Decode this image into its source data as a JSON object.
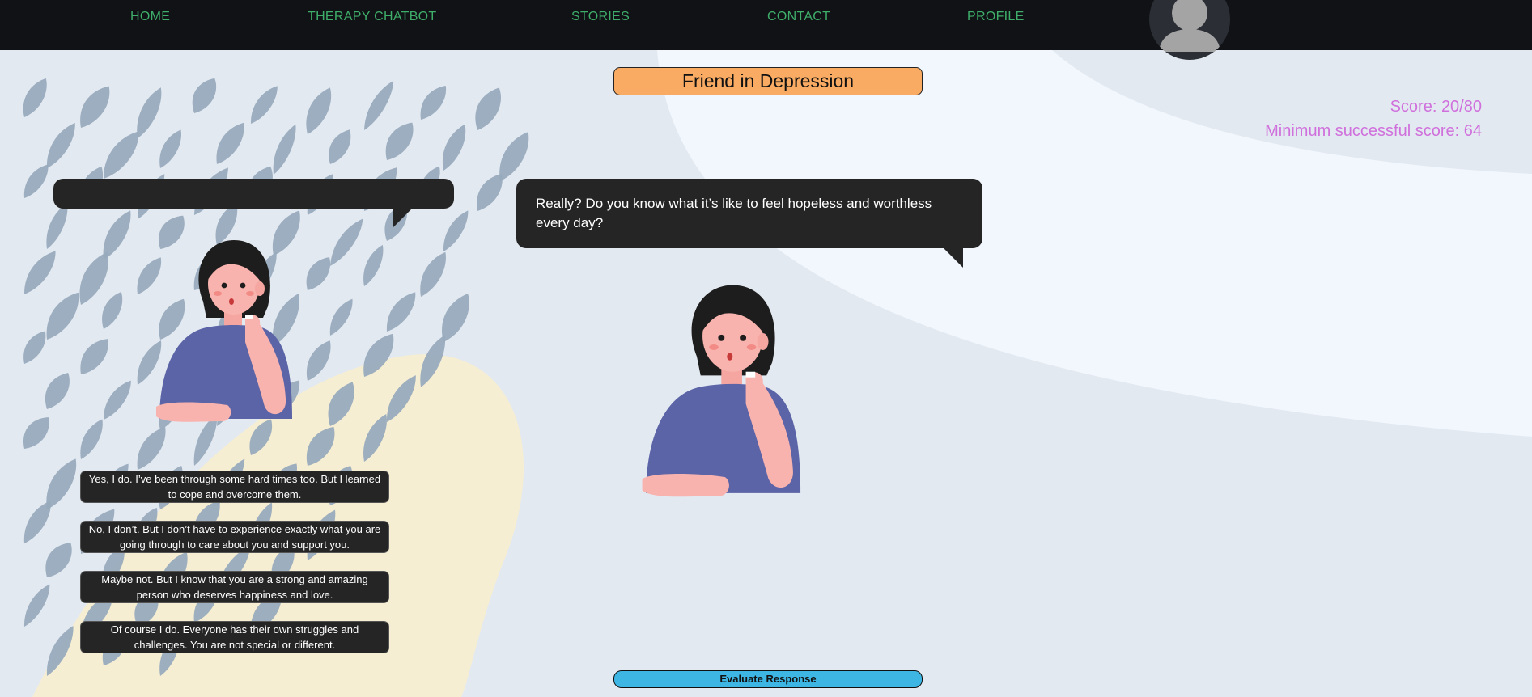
{
  "nav": {
    "items": [
      {
        "label": "HOME"
      },
      {
        "label": "THERAPY CHATBOT"
      },
      {
        "label": "STORIES"
      },
      {
        "label": "CONTACT"
      },
      {
        "label": "PROFILE"
      }
    ],
    "avatar_icon": "user-silhouette-icon"
  },
  "scenario": {
    "title": "Friend in Depression"
  },
  "score": {
    "current": "Score: 20/80",
    "minimum": "Minimum successful score: 64"
  },
  "conversation": {
    "user_bubble": "",
    "friend_bubble": "Really? Do you know what it’s like to feel hopeless and worthless every day?"
  },
  "options": [
    {
      "text": "Yes, I do. I’ve been through some hard times too. But I learned to cope and overcome them."
    },
    {
      "text": "No, I don’t. But I don’t have to experience exactly what you are going through to care about you and support you."
    },
    {
      "text": "Maybe not. But I know that you are a strong and amazing person who deserves happiness and love."
    },
    {
      "text": "Of course I do. Everyone has their own struggles and challenges. You are not special or different."
    }
  ],
  "actions": {
    "evaluate_label": "Evaluate Response"
  },
  "colors": {
    "navbar": "#101216",
    "nav_link": "#3fae6a",
    "title_bg": "#f9ab63",
    "score_text": "#d070dc",
    "bubble_bg": "#252525",
    "evaluate_bg": "#3eb6e4",
    "page_bg": "#e3e9f1"
  }
}
